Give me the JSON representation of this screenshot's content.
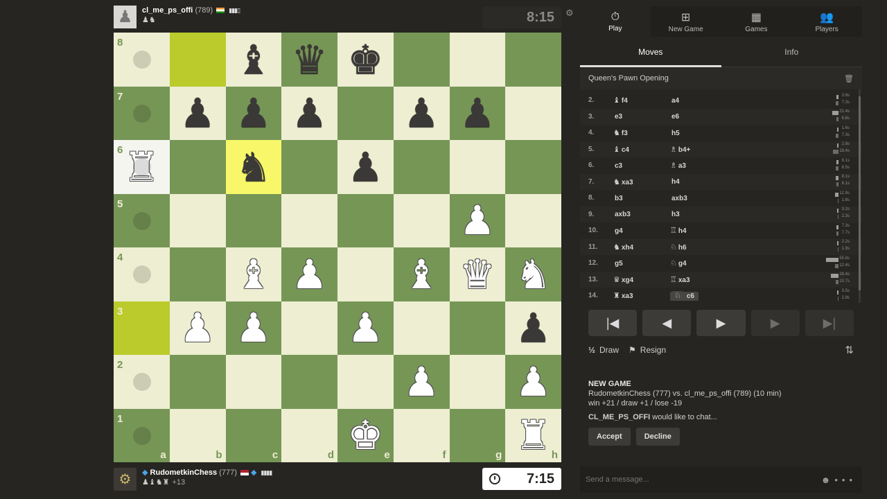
{
  "top_player": {
    "name": "cl_me_ps_offi",
    "rating": "(789)",
    "bars": "▮▮▮▯",
    "captured": "♟♞"
  },
  "bottom_player": {
    "name": "RudometkinChess",
    "rating": "(777)",
    "bars": "▮▮▮▮",
    "captured": "♟♝♞♜",
    "material": "+13",
    "diamond": "◆"
  },
  "clocks": {
    "top": "8:15",
    "bottom": "7:15"
  },
  "board": {
    "files": [
      "a",
      "b",
      "c",
      "d",
      "e",
      "f",
      "g",
      "h"
    ],
    "ranks": [
      "8",
      "7",
      "6",
      "5",
      "4",
      "3",
      "2",
      "1"
    ],
    "pieces": [
      [
        "",
        "",
        "♝",
        "♛",
        "♚",
        "",
        "",
        ""
      ],
      [
        "",
        "♟",
        "♟",
        "♟",
        "",
        "♟",
        "♟",
        ""
      ],
      [
        "R",
        "",
        "♞",
        "",
        "♟",
        "",
        "",
        ""
      ],
      [
        "",
        "",
        "",
        "",
        "",
        "",
        "P",
        ""
      ],
      [
        "",
        "",
        "B",
        "P",
        "",
        "B",
        "Q",
        "N"
      ],
      [
        "",
        "P",
        "P",
        "",
        "P",
        "",
        "",
        "♟"
      ],
      [
        "",
        "",
        "",
        "",
        "",
        "P",
        "",
        "P"
      ],
      [
        "",
        "",
        "",
        "",
        "K",
        "",
        "",
        "R"
      ]
    ],
    "highlight": [
      "b8",
      "c6",
      "a3"
    ],
    "selected": "a6",
    "hints": [
      "a8",
      "a7",
      "a6",
      "a5",
      "a4",
      "a2",
      "a1"
    ]
  },
  "nav": [
    {
      "label": "Play",
      "icon": "⏱",
      "active": true
    },
    {
      "label": "New Game",
      "icon": "⊞",
      "active": false
    },
    {
      "label": "Games",
      "icon": "▦",
      "active": false
    },
    {
      "label": "Players",
      "icon": "👥",
      "active": false
    }
  ],
  "tabs": {
    "moves": "Moves",
    "info": "Info"
  },
  "opening": "Queen's Pawn Opening",
  "moves": [
    {
      "n": "2.",
      "wp": "♝",
      "w": "f4",
      "bp": "",
      "b": "a4",
      "t1": "3.9s",
      "t2": "7.3s",
      "w1": 3,
      "w2": 4
    },
    {
      "n": "3.",
      "wp": "",
      "w": "e3",
      "bp": "",
      "b": "e6",
      "t1": "21.4s",
      "t2": "6.8s",
      "w1": 9,
      "w2": 3
    },
    {
      "n": "4.",
      "wp": "♞",
      "w": "f3",
      "bp": "",
      "b": "h5",
      "t1": "1.6s",
      "t2": "7.3s",
      "w1": 2,
      "w2": 4
    },
    {
      "n": "5.",
      "wp": "♝",
      "w": "c4",
      "bp": "♗",
      "b": "b4+",
      "t1": "2.8s",
      "t2": "18.4s",
      "w1": 2,
      "w2": 8
    },
    {
      "n": "6.",
      "wp": "",
      "w": "c3",
      "bp": "♗",
      "b": "a3",
      "t1": "6.1s",
      "t2": "8.5s",
      "w1": 3,
      "w2": 4
    },
    {
      "n": "7.",
      "wp": "♞",
      "w": "xa3",
      "bp": "",
      "b": "h4",
      "t1": "8.1s",
      "t2": "6.1s",
      "w1": 4,
      "w2": 3
    },
    {
      "n": "8.",
      "wp": "",
      "w": "b3",
      "bp": "",
      "b": "axb3",
      "t1": "12.9s",
      "t2": "1.8s",
      "w1": 5,
      "w2": 1
    },
    {
      "n": "9.",
      "wp": "",
      "w": "axb3",
      "bp": "",
      "b": "h3",
      "t1": "3.2s",
      "t2": "2.3s",
      "w1": 2,
      "w2": 1
    },
    {
      "n": "10.",
      "wp": "",
      "w": "g4",
      "bp": "♖",
      "b": "h4",
      "t1": "7.3s",
      "t2": "7.7s",
      "w1": 3,
      "w2": 3
    },
    {
      "n": "11.",
      "wp": "♞",
      "w": "xh4",
      "bp": "♘",
      "b": "h6",
      "t1": "2.2s",
      "t2": "1.9s",
      "w1": 2,
      "w2": 1
    },
    {
      "n": "12.",
      "wp": "",
      "w": "g5",
      "bp": "♘",
      "b": "g4",
      "t1": "55.8s",
      "t2": "12.4s",
      "w1": 18,
      "w2": 5
    },
    {
      "n": "13.",
      "wp": "♛",
      "w": "xg4",
      "bp": "♖",
      "b": "xa3",
      "t1": "28.4s",
      "t2": "10.7s",
      "w1": 11,
      "w2": 4
    },
    {
      "n": "14.",
      "wp": "♜",
      "w": "xa3",
      "bp": "♘",
      "b": "c6",
      "t1": "3.5s",
      "t2": "2.9s",
      "w1": 2,
      "w2": 1
    }
  ],
  "controls": [
    "|◀",
    "◀",
    "▶",
    "▶",
    "▶|"
  ],
  "actions": {
    "draw_icon": "½",
    "draw": "Draw",
    "resign_icon": "⚑",
    "resign": "Resign",
    "flip_icon": "⇅"
  },
  "chat": {
    "head": "NEW GAME",
    "line1": "RudometkinChess (777) vs. cl_me_ps_offi (789) (10 min)",
    "line2": "win +21 / draw +1 / lose -19",
    "req_name": "CL_ME_PS_OFFI",
    "req_text": " would like to chat...",
    "accept": "Accept",
    "decline": "Decline"
  },
  "message": {
    "placeholder": "Send a message...",
    "emoji": "☻",
    "more": "•••"
  }
}
